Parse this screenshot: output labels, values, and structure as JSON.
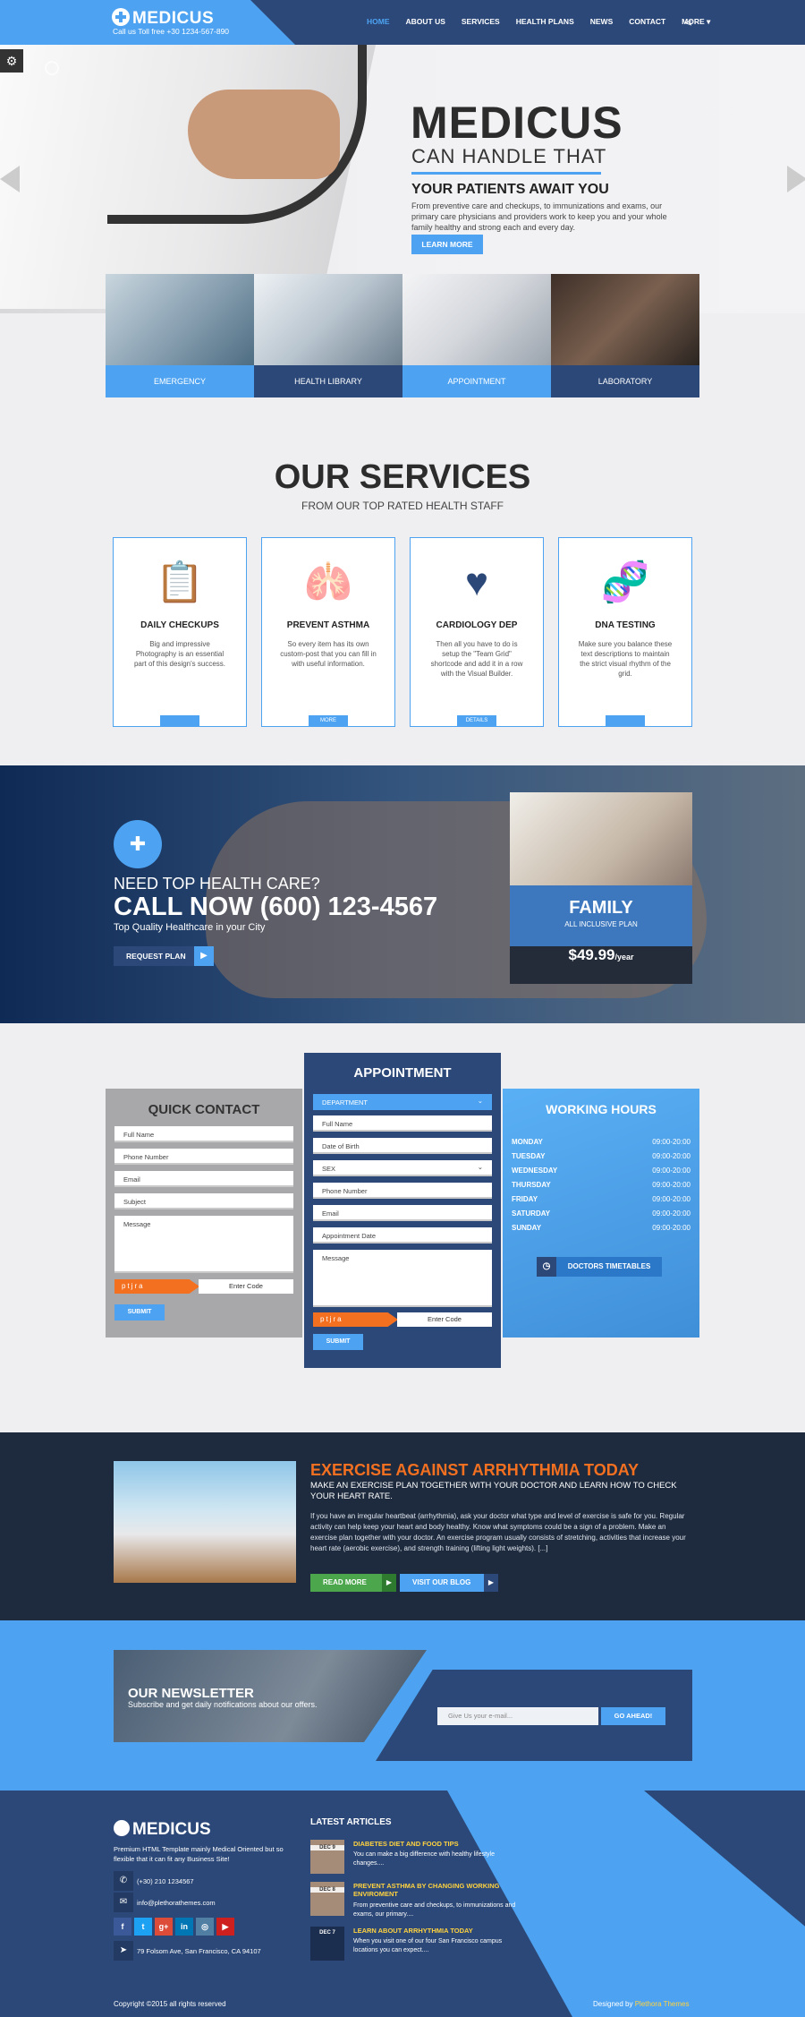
{
  "header": {
    "logo": "MEDICUS",
    "tagline": "Call us Toll free +30 1234-567-890",
    "nav": [
      "HOME",
      "ABOUT US",
      "SERVICES",
      "HEALTH PLANS",
      "NEWS",
      "CONTACT",
      "MORE ▾"
    ],
    "active_nav": "HOME"
  },
  "hero": {
    "title": "MEDICUS",
    "subtitle": "CAN HANDLE THAT",
    "heading": "YOUR PATIENTS AWAIT YOU",
    "paragraph": "From preventive care and checkups, to immunizations and exams, our primary care physicians and providers work to keep you and your whole family healthy and strong each and every day.",
    "button": "LEARN MORE"
  },
  "features": [
    {
      "label": "EMERGENCY",
      "color": "#4da3f2"
    },
    {
      "label": "HEALTH LIBRARY",
      "color": "#2b4878"
    },
    {
      "label": "APPOINTMENT",
      "color": "#4da3f2"
    },
    {
      "label": "LABORATORY",
      "color": "#2b4878"
    }
  ],
  "services": {
    "title": "OUR SERVICES",
    "subtitle": "FROM OUR TOP RATED HEALTH STAFF",
    "items": [
      {
        "title": "DAILY CHECKUPS",
        "text": "Big and impressive Photography is an essential part of this design's success.",
        "button": "",
        "icon": "clipboard-icon"
      },
      {
        "title": "PREVENT ASTHMA",
        "text": "So every item has its own custom-post that you can fill in with useful information.",
        "button": "MORE",
        "icon": "lungs-icon"
      },
      {
        "title": "CARDIOLOGY DEP",
        "text": "Then all you have to do is setup the \"Team Grid\" shortcode and add it in a row with the Visual Builder.",
        "button": "DETAILS",
        "icon": "heart-icon"
      },
      {
        "title": "DNA TESTING",
        "text": "Make sure you balance these text descriptions to maintain the strict visual rhythm of the grid.",
        "button": "",
        "icon": "dna-icon"
      }
    ]
  },
  "call": {
    "line1": "NEED TOP HEALTH CARE?",
    "line2": "CALL NOW (600) 123-4567",
    "line3": "Top Quality Healthcare in your City",
    "button": "REQUEST PLAN",
    "plan_title": "FAMILY",
    "plan_sub": "ALL INCLUSIVE PLAN",
    "plan_price": "$49.99",
    "plan_period": "/year"
  },
  "quick_contact": {
    "title": "QUICK CONTACT",
    "fields": [
      "Full Name",
      "Phone Number",
      "Email",
      "Subject",
      "Message"
    ],
    "captcha_text": "ptjra",
    "captcha_placeholder": "Enter Code",
    "submit": "SUBMIT"
  },
  "appointment": {
    "title": "APPOINTMENT",
    "department": "DEPARTMENT",
    "fields": [
      "Full Name",
      "Date of Birth",
      "SEX",
      "Phone Number",
      "Email",
      "Appointment Date",
      "Message"
    ],
    "captcha_text": "ptjra",
    "captcha_placeholder": "Enter Code",
    "submit": "SUBMIT"
  },
  "working_hours": {
    "title": "WORKING HOURS",
    "rows": [
      {
        "day": "MONDAY",
        "hours": "09:00-20:00"
      },
      {
        "day": "TUESDAY",
        "hours": "09:00-20:00"
      },
      {
        "day": "WEDNESDAY",
        "hours": "09:00-20:00"
      },
      {
        "day": "THURSDAY",
        "hours": "09:00-20:00"
      },
      {
        "day": "FRIDAY",
        "hours": "09:00-20:00"
      },
      {
        "day": "SATURDAY",
        "hours": "09:00-20:00"
      },
      {
        "day": "SUNDAY",
        "hours": "09:00-20:00"
      }
    ],
    "button": "DOCTORS TIMETABLES"
  },
  "exercise": {
    "title": "EXERCISE AGAINST ARRHYTHMIA TODAY",
    "subtitle": "MAKE AN EXERCISE PLAN TOGETHER WITH YOUR DOCTOR AND LEARN HOW TO CHECK YOUR HEART RATE.",
    "paragraph": "If you have an irregular heartbeat (arrhythmia), ask your doctor what type and level of exercise is safe for you. Regular activity can help keep your heart and body healthy. Know what symptoms could be a sign of a problem. Make an exercise plan together with your doctor. An exercise program usually consists of stretching, activities that increase your heart rate (aerobic exercise), and strength training (lifting light weights). [...]",
    "btn_read": "READ MORE",
    "btn_blog": "VISIT OUR BLOG"
  },
  "newsletter": {
    "title": "OUR NEWSLETTER",
    "desc": "Subscribe and get daily notifications about our offers.",
    "placeholder": "Give Us your e-mail...",
    "button": "GO AHEAD!"
  },
  "footer": {
    "logo": "MEDICUS",
    "desc": "Premium HTML Template mainly Medical Oriented but so flexible that it can fit any Business Site!",
    "phone": "(+30) 210 1234567",
    "email": "info@plethorathemes.com",
    "address": "79 Folsom Ave, San Francisco, CA 94107",
    "social": [
      {
        "icon": "f",
        "color": "#3b5998"
      },
      {
        "icon": "t",
        "color": "#1da1f2"
      },
      {
        "icon": "g+",
        "color": "#dd4b39"
      },
      {
        "icon": "in",
        "color": "#0077b5"
      },
      {
        "icon": "◎",
        "color": "#517fa4"
      },
      {
        "icon": "▶",
        "color": "#cd201f"
      }
    ],
    "articles_title": "LATEST ARTICLES",
    "articles": [
      {
        "date": "DEC 9",
        "title": "DIABETES DIET AND FOOD TIPS",
        "text": "You can make a big difference with healthy lifestyle changes...."
      },
      {
        "date": "DEC 8",
        "title": "PREVENT ASTHMA BY CHANGING WORKING ENVIROMENT",
        "text": "From preventive care and checkups, to immunizations and exams, our primary...."
      },
      {
        "date": "DEC 7",
        "title": "LEARN ABOUT ARRHYTHMIA TODAY",
        "text": "When you visit one of our four San Francisco campus locations you can expect...."
      }
    ],
    "copyright": "Copyright ©2015 all rights reserved",
    "designed_label": "Designed by",
    "designed_by": "Plethora Themes"
  }
}
